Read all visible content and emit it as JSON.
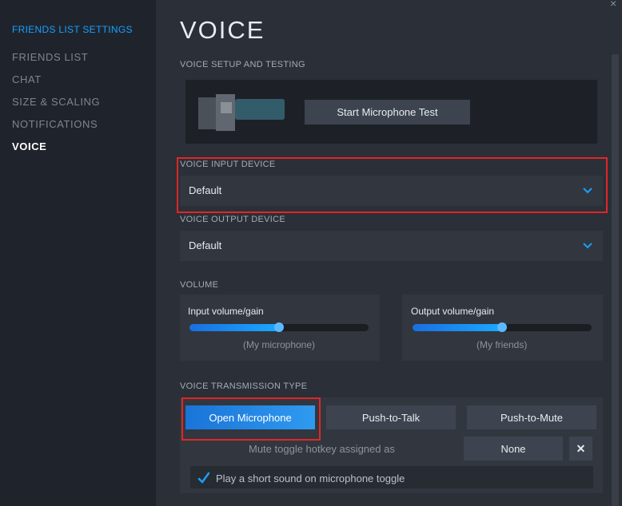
{
  "sidebar": {
    "title": "FRIENDS LIST SETTINGS",
    "items": [
      {
        "label": "FRIENDS LIST"
      },
      {
        "label": "CHAT"
      },
      {
        "label": "SIZE & SCALING"
      },
      {
        "label": "NOTIFICATIONS"
      },
      {
        "label": "VOICE",
        "active": true
      }
    ]
  },
  "page": {
    "title": "VOICE",
    "close_glyph": "×"
  },
  "setup": {
    "section_label": "VOICE SETUP AND TESTING",
    "test_button": "Start Microphone Test"
  },
  "input_device": {
    "label": "VOICE INPUT DEVICE",
    "value": "Default"
  },
  "output_device": {
    "label": "VOICE OUTPUT DEVICE",
    "value": "Default"
  },
  "volume": {
    "section_label": "VOLUME",
    "input": {
      "label": "Input volume/gain",
      "sublabel": "(My microphone)",
      "level": 0.5
    },
    "output": {
      "label": "Output volume/gain",
      "sublabel": "(My friends)",
      "level": 0.5
    }
  },
  "transmission": {
    "section_label": "VOICE TRANSMISSION TYPE",
    "options": [
      "Open Microphone",
      "Push-to-Talk",
      "Push-to-Mute"
    ],
    "selected": "Open Microphone",
    "hotkey_label": "Mute toggle hotkey assigned as",
    "hotkey_value": "None",
    "clear_glyph": "✕",
    "sound_toggle_label": "Play a short sound on microphone toggle",
    "sound_toggle_checked": true
  },
  "colors": {
    "accent": "#1a9fff",
    "highlight": "#e12626",
    "background": "#2a2f38"
  }
}
